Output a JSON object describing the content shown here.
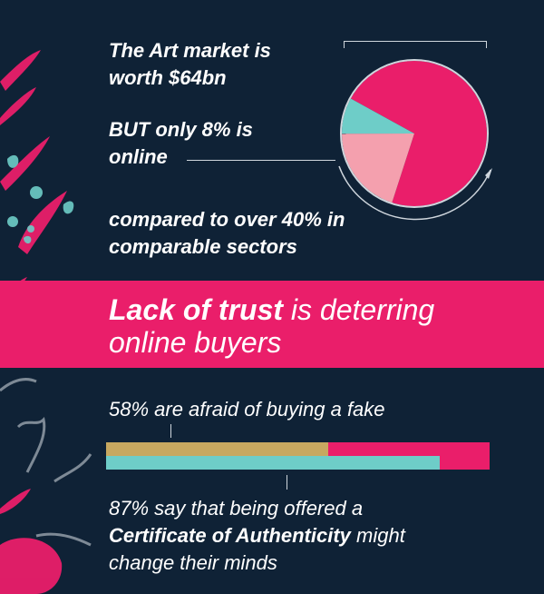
{
  "stats": {
    "market_line1": "The Art market is",
    "market_line2": "worth $64bn",
    "online_line1": "BUT only 8% is",
    "online_line2": "online",
    "compared_line1": "compared to over 40% in",
    "compared_line2": "comparable sectors"
  },
  "banner": {
    "bold_text": "Lack of trust",
    "line1_rest": " is deterring",
    "line2": "online buyers"
  },
  "fake": {
    "text": "58% are afraid of buying a fake",
    "percent": 58
  },
  "certificate": {
    "line1": "87% say that being offered a",
    "bold_text": "Certificate of Authenticity",
    "line2_rest": " might",
    "line3": "change their minds",
    "percent": 87
  },
  "pie": {
    "type": "pie",
    "slices": [
      {
        "value": 72,
        "color": "#ea1e6a"
      },
      {
        "value": 20,
        "color": "#f4a0ae"
      },
      {
        "value": 8,
        "color": "#6ecdc8"
      }
    ]
  },
  "colors": {
    "background": "#0f2236",
    "accent": "#ea1e6a",
    "teal": "#6ecdc8",
    "gold": "#c7a860",
    "light_pink": "#f4a0ae"
  }
}
